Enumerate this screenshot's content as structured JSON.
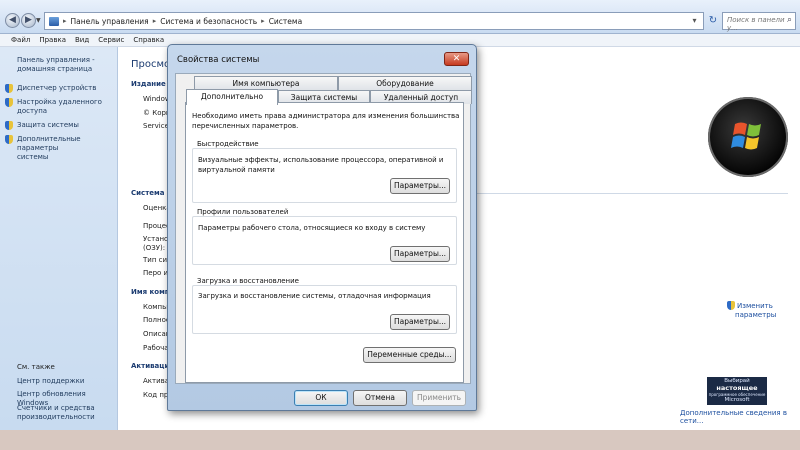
{
  "address_bar": {
    "breadcrumb": [
      "Панель управления",
      "Система и безопасность",
      "Система"
    ],
    "search_placeholder": "Поиск в панели у...",
    "icons": {
      "back": "back-arrow-icon",
      "forward": "forward-arrow-icon",
      "refresh": "refresh-icon",
      "search": "search-icon"
    }
  },
  "menu": [
    "Файл",
    "Правка",
    "Вид",
    "Сервис",
    "Справка"
  ],
  "sidebar": {
    "home_link": [
      "Панель управления -",
      "домашняя страница"
    ],
    "items": [
      {
        "label": [
          "Диспетчер устройств"
        ]
      },
      {
        "label": [
          "Настройка удаленного",
          "доступа"
        ]
      },
      {
        "label": [
          "Защита системы"
        ]
      },
      {
        "label": [
          "Дополнительные параметры",
          "системы"
        ]
      }
    ],
    "see_also_title": "См. также",
    "see_also": [
      "Центр поддержки",
      "Центр обновления Windows",
      "Счетчики и средства",
      "производительности"
    ]
  },
  "content": {
    "title": "Просмот",
    "edition_heading": "Издание W",
    "edition_lines": [
      "Window",
      "© Корп",
      "Service"
    ],
    "system_heading": "Система",
    "system_lines": [
      "Оценка",
      "Процес",
      "Установ",
      "(ОЗУ):",
      "Тип сис",
      "Перо и"
    ],
    "computer_heading": "Имя компью",
    "computer_lines": [
      "Компью",
      "Полное",
      "Описан",
      "Рабоча"
    ],
    "activation_heading": "Активация",
    "activation_lines": [
      "Активац",
      "Код про"
    ],
    "change_params": [
      "Изменить",
      "параметры"
    ],
    "genuine_lines": [
      "Выбирай",
      "настоящее",
      "программное обеспечение",
      "Microsoft"
    ],
    "more_info": "Дополнительные сведения в сети..."
  },
  "dialog": {
    "title": "Свойства системы",
    "tabs_row1": [
      "Имя компьютера",
      "Оборудование"
    ],
    "tabs_row2": [
      "Дополнительно",
      "Защита системы",
      "Удаленный доступ"
    ],
    "active_tab": "Дополнительно",
    "note": "Необходимо иметь права администратора для изменения большинства перечисленных параметров.",
    "groups": [
      {
        "title": "Быстродействие",
        "text": "Визуальные эффекты, использование процессора, оперативной и виртуальной памяти",
        "button": "Параметры..."
      },
      {
        "title": "Профили пользователей",
        "text": "Параметры рабочего стола, относящиеся ко входу в систему",
        "button": "Параметры..."
      },
      {
        "title": "Загрузка и восстановление",
        "text": "Загрузка и восстановление системы, отладочная информация",
        "button": "Параметры..."
      }
    ],
    "env_button": "Переменные среды...",
    "ok": "ОК",
    "cancel": "Отмена",
    "apply": "Применить"
  },
  "colors": {
    "link": "#1a4d9e",
    "heading": "#1b3b70",
    "close_button": "#c6391f"
  }
}
